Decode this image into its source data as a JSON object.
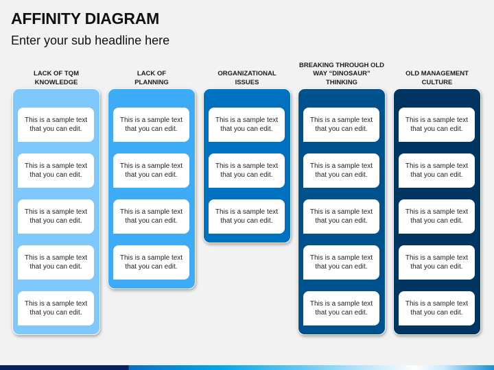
{
  "header": {
    "title": "AFFINITY DIAGRAM",
    "subtitle": "Enter your sub headline here"
  },
  "columns": [
    {
      "heading": [
        "LACK OF TQM",
        "KNOWLEDGE"
      ],
      "color": "#7fc8fb",
      "cards": [
        [
          "This is a sample text",
          "that you can edit."
        ],
        [
          "This is a sample text",
          "that you can edit."
        ],
        [
          "This is a sample text",
          "that you can edit."
        ],
        [
          "This is a sample text",
          "that you can edit."
        ],
        [
          "This is a sample text",
          "that you can edit."
        ]
      ]
    },
    {
      "heading": [
        "LACK OF",
        "PLANNING"
      ],
      "color": "#3eabf6",
      "cards": [
        [
          "This is a sample text",
          "that you can edit."
        ],
        [
          "This is a sample text",
          "that you can edit."
        ],
        [
          "This is a sample text",
          "that you can edit."
        ],
        [
          "This is a sample text",
          "that you can edit."
        ]
      ]
    },
    {
      "heading": [
        "ORGANIZATIONAL",
        "ISSUES"
      ],
      "color": "#0070c0",
      "cards": [
        [
          "This is a sample text",
          "that you can edit."
        ],
        [
          "This is a sample text",
          "that you can edit."
        ],
        [
          "This is a sample text",
          "that you can edit."
        ]
      ]
    },
    {
      "heading": [
        "BREAKING THROUGH OLD",
        "WAY “DINOSAUR”",
        "THINKING"
      ],
      "color": "#00528f",
      "cards": [
        [
          "This is a sample text",
          "that you can edit."
        ],
        [
          "This is a sample text",
          "that you can edit."
        ],
        [
          "This is a sample text",
          "that you can edit."
        ],
        [
          "This is a sample text",
          "that you can edit."
        ],
        [
          "This is a sample text",
          "that you can edit."
        ]
      ]
    },
    {
      "heading": [
        "OLD MANAGEMENT",
        "CULTURE"
      ],
      "color": "#003561",
      "cards": [
        [
          "This is a sample text",
          "that you can edit."
        ],
        [
          "This is a sample text",
          "that you can edit."
        ],
        [
          "This is a sample text",
          "that you can edit."
        ],
        [
          "This is a sample text",
          "that you can edit."
        ],
        [
          "This is a sample text",
          "that you can edit."
        ]
      ]
    }
  ]
}
